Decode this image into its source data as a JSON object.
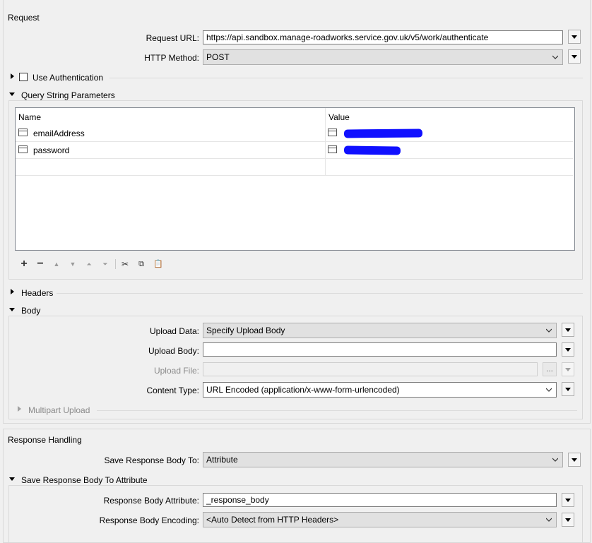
{
  "request": {
    "section_label": "Request",
    "url_label": "Request URL:",
    "url_value": "https://api.sandbox.manage-roadworks.service.gov.uk/v5/work/authenticate",
    "method_label": "HTTP Method:",
    "method_value": "POST",
    "use_auth_label": "Use Authentication",
    "query_label": "Query String Parameters",
    "table": {
      "col_name": "Name",
      "col_value": "Value",
      "rows": [
        {
          "name": "emailAddress",
          "value": ""
        },
        {
          "name": "password",
          "value": ""
        }
      ]
    },
    "headers_label": "Headers",
    "body": {
      "section_label": "Body",
      "upload_data_label": "Upload Data:",
      "upload_data_value": "Specify Upload Body",
      "upload_body_label": "Upload Body:",
      "upload_body_value": "",
      "upload_file_label": "Upload File:",
      "upload_file_value": "",
      "browse_label": "...",
      "content_type_label": "Content Type:",
      "content_type_value": "URL Encoded (application/x-www-form-urlencoded)",
      "multipart_label": "Multipart Upload"
    }
  },
  "response": {
    "section_label": "Response Handling",
    "save_to_label": "Save Response Body To:",
    "save_to_value": "Attribute",
    "save_attr_section_label": "Save Response Body To Attribute",
    "attr_label": "Response Body Attribute:",
    "attr_value": "_response_body",
    "encoding_label": "Response Body Encoding:",
    "encoding_value": "<Auto Detect from HTTP Headers>"
  },
  "colors": {
    "redaction": "#1010ff"
  }
}
